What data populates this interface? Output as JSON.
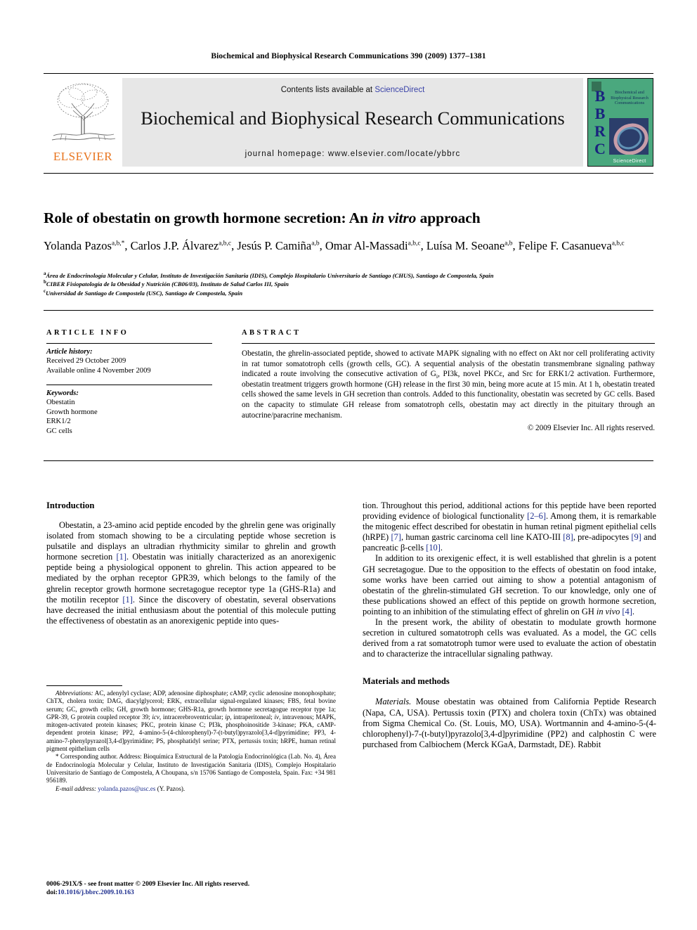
{
  "running_head": "Biochemical and Biophysical Research Communications 390 (2009) 1377–1381",
  "masthead": {
    "contents_prefix": "Contents lists available at ",
    "sciencedirect": "ScienceDirect",
    "journal_title": "Biochemical and Biophysical Research Communications",
    "homepage": "journal homepage: www.elsevier.com/locate/ybbrc",
    "elsevier_wordmark": "ELSEVIER",
    "cover": {
      "letters": "BBRC",
      "cover_title": "Biochemical and Biophysical Research Communications",
      "footmark": "ScienceDirect"
    },
    "colors": {
      "band_background": "#e7e7e7",
      "sciencedirect_link": "#3a43a8",
      "elsevier_orange": "#E8741E",
      "cover_green": "#4aa87e",
      "cover_letters": "#1a237e"
    }
  },
  "article": {
    "title_part1": "Role of obestatin on growth hormone secretion: An ",
    "title_italic": "in vitro",
    "title_part2": " approach",
    "authors": [
      {
        "name": "Yolanda Pazos",
        "sup": "a,b,*",
        "sep": ", "
      },
      {
        "name": "Carlos J.P. Álvarez",
        "sup": "a,b,c",
        "sep": ", "
      },
      {
        "name": "Jesús P. Camiña",
        "sup": "a,b",
        "sep": ", "
      },
      {
        "name": "Omar Al-Massadi",
        "sup": "a,b,c",
        "sep": ", "
      },
      {
        "name": "Luísa M. Seoane",
        "sup": "a,b",
        "sep": ","
      },
      {
        "name": "Felipe F. Casanueva",
        "sup": "a,b,c",
        "sep": ""
      }
    ],
    "affiliations": [
      {
        "sup": "a",
        "text": "Área de Endocrinología Molecular y Celular, Instituto de Investigación Sanitaria (IDIS), Complejo Hospitalario Universitario de Santiago (CHUS), Santiago de Compostela, Spain"
      },
      {
        "sup": "b",
        "text": "CIBER Fisiopatología de la Obesidad y Nutrición (CB06/03), Instituto de Salud Carlos III, Spain"
      },
      {
        "sup": "c",
        "text": "Universidad de Santiago de Compostela (USC), Santiago de Compostela, Spain"
      }
    ]
  },
  "article_info": {
    "heading": "ARTICLE INFO",
    "history_label": "Article history:",
    "history": [
      "Received 29 October 2009",
      "Available online 4 November 2009"
    ],
    "keywords_label": "Keywords:",
    "keywords": [
      "Obestatin",
      "Growth hormone",
      "ERK1/2",
      "GC cells"
    ]
  },
  "abstract": {
    "heading": "ABSTRACT",
    "p1_a": "Obestatin, the ghrelin-associated peptide, showed to activate MAPK signaling with no effect on Akt nor cell proliferating activity in rat tumor somatotroph cells (growth cells, GC). A sequential analysis of the obestatin transmembrane signaling pathway indicated a route involving the consecutive activation of G",
    "p1_sub": "i",
    "p1_b": ", PI3k, novel PKCε, and Src for ERK1/2 activation. Furthermore, obestatin treatment triggers growth hormone (GH) release in the first 30 min, being more acute at 15 min. At 1 h, obestatin treated cells showed the same levels in GH secretion than controls. Added to this functionality, obestatin was secreted by GC cells. Based on the capacity to stimulate GH release from somatotroph cells, obestatin may act directly in the pituitary through an autocrine/paracrine mechanism.",
    "copyright": "© 2009 Elsevier Inc. All rights reserved."
  },
  "body": {
    "intro_heading": "Introduction",
    "intro_p1": "Obestatin, a 23-amino acid peptide encoded by the ghrelin gene was originally isolated from stomach showing to be a circulating peptide whose secretion is pulsatile and displays an ultradian rhythmicity similar to ghrelin and growth hormone secretion [1]. Obestatin was initially characterized as an anorexigenic peptide being a physiological opponent to ghrelin. This action appeared to be mediated by the orphan receptor GPR39, which belongs to the family of the ghrelin receptor growth hormone secretagogue receptor type 1a (GHS-R1a) and the motilin receptor [1]. Since the discovery of obestatin, several observations have decreased the initial enthusiasm about the potential of this molecule putting the effectiveness of obestatin as an anorexigenic peptide into ques-",
    "intro_p1_cont": "tion. Throughout this period, additional actions for this peptide have been reported providing evidence of biological functionality [2–6]. Among them, it is remarkable the mitogenic effect described for obestatin in human retinal pigment epithelial cells (hRPE) [7], human gastric carcinoma cell line KATO-III [8], pre-adipocytes [9] and pancreatic β-cells [10].",
    "intro_p2": "In addition to its orexigenic effect, it is well established that ghrelin is a potent GH secretagogue. Due to the opposition to the effects of obestatin on food intake, some works have been carried out aiming to show a potential antagonism of obestatin of the ghrelin-stimulated GH secretion. To our knowledge, only one of these publications showed an effect of this peptide on growth hormone secretion, pointing to an inhibition of the stimulating effect of ghrelin on GH in vivo [4].",
    "intro_p3": "In the present work, the ability of obestatin to modulate growth hormone secretion in cultured somatotroph cells was evaluated. As a model, the GC cells derived from a rat somatotroph tumor were used to evaluate the action of obestatin and to characterize the intracellular signaling pathway.",
    "methods_heading": "Materials and methods",
    "materials_label": "Materials.",
    "materials_text": " Mouse obestatin was obtained from California Peptide Research (Napa, CA, USA). Pertussis toxin (PTX) and cholera toxin (ChTx) was obtained from Sigma Chemical Co. (St. Louis, MO, USA). Wortmannin and 4-amino-5-(4-chlorophenyl)-7-(t-butyl)pyrazolo[3,4-d]pyrimidine (PP2) and calphostin C were purchased from Calbiochem (Merck KGaA, Darmstadt, DE). Rabbit"
  },
  "footnotes": {
    "abbrev_label": "Abbreviations:",
    "abbrev_text": " AC, adenylyl cyclase; ADP, adenosine diphosphate; cAMP, cyclic adenosine monophosphate; ChTX, cholera toxin; DAG, diacylglycerol; ERK, extracellular signal-regulated kinases; FBS, fetal bovine serum; GC, growth cells; GH, growth hormone; GHS-R1a, growth hormone secretagogue receptor type 1a; GPR-39, G protein coupled receptor 39; icv, intracerebroventricular; ip, intraperitoneal; iv, intravenous; MAPK, mitogen-activated protein kinases; PKC, protein kinase C; PI3k, phosphoinositide 3-kinase; PKA, cAMP-dependent protein kinase; PP2, 4-amino-5-(4-chlorophenyl)-7-(t-butyl)pyrazolo[3,4-d]pyrimidine; PP3, 4-amino-7-phenylpyrazol[3,4-d]pyrimidine; PS, phosphatidyl serine; PTX, pertussis toxin; hRPE, human retinal pigment epithelium cells",
    "corresponding_marker": "* ",
    "corresponding_text": "Corresponding author. Address: Bioquímica Estructural de la Patología Endocrinológica (Lab. No. 4), Área de Endocrinología Molecular y Celular, Instituto de Investigación Sanitaria (IDIS), Complejo Hospitalario Universitario de Santiago de Compostela, A Choupana, s/n 15706 Santiago de Compostela, Spain. Fax: +34 981 956189.",
    "email_label": "E-mail address:",
    "email": "yolanda.pazos@usc.es",
    "email_suffix": " (Y. Pazos)."
  },
  "imprint": {
    "issn_line": "0006-291X/$ - see front matter © 2009 Elsevier Inc. All rights reserved.",
    "doi_label": "doi:",
    "doi": "10.1016/j.bbrc.2009.10.163"
  }
}
